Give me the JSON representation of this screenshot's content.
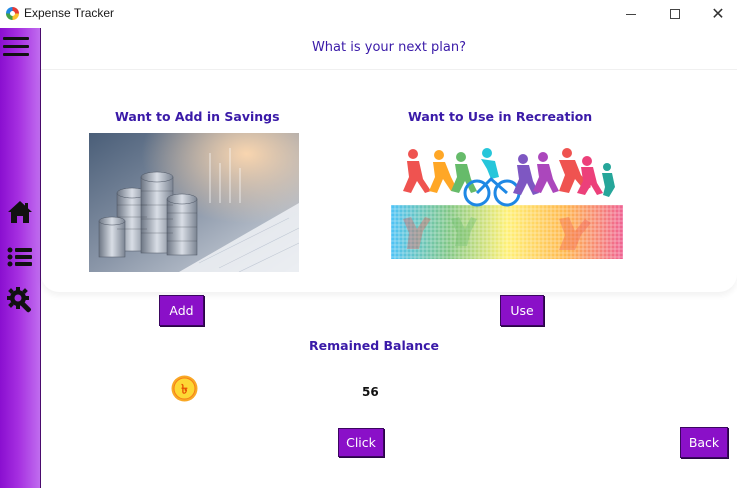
{
  "window": {
    "title": "Expense Tracker",
    "minimize_glyph": "",
    "maximize_glyph": "",
    "close_glyph": "✕"
  },
  "sidebar": {
    "icons": [
      "menu-icon",
      "home-icon",
      "list-icon",
      "settings-icon"
    ],
    "background": "#9b22d8"
  },
  "header": {
    "question": "What is your next plan?"
  },
  "options": {
    "savings": {
      "title": "Want to Add in Savings",
      "button_label": "Add"
    },
    "recreation": {
      "title": "Want to Use in Recreation",
      "button_label": "Use"
    }
  },
  "balance": {
    "label": "Remained Balance",
    "value": "56"
  },
  "actions": {
    "click_label": "Click",
    "back_label": "Back"
  },
  "colors": {
    "accent": "#8a10c8",
    "heading": "#3a1aa8"
  }
}
